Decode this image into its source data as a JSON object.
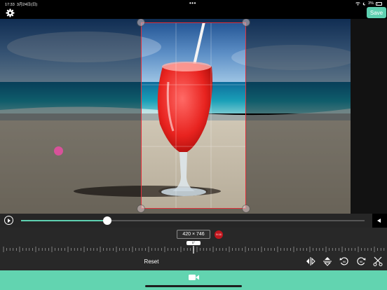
{
  "status_bar": {
    "time": "17:33",
    "date": "3月24日(日)",
    "dots": "•••",
    "battery": "3%"
  },
  "toolbar": {
    "save_label": "Save",
    "settings_icon": "gear-icon"
  },
  "editor": {
    "dimensions": "420 × 746",
    "aspect_ratio": "9:16",
    "rotation_angle": "0°"
  },
  "playback": {
    "progress": 0.25,
    "play_icon": "play-icon",
    "end_icon": "triangle-left-icon"
  },
  "actions": {
    "reset_label": "Reset",
    "tools": [
      "flip-horizontal-icon",
      "flip-vertical-icon",
      "rotate-left-icon",
      "rotate-right-icon",
      "scissors-icon"
    ]
  },
  "bottom_bar": {
    "icon": "video-camera-icon"
  },
  "colors": {
    "accent": "#5ed0b0",
    "bottom_bar": "#62d4b0",
    "crop_border": "#e0303a",
    "badge": "#c1161e"
  }
}
